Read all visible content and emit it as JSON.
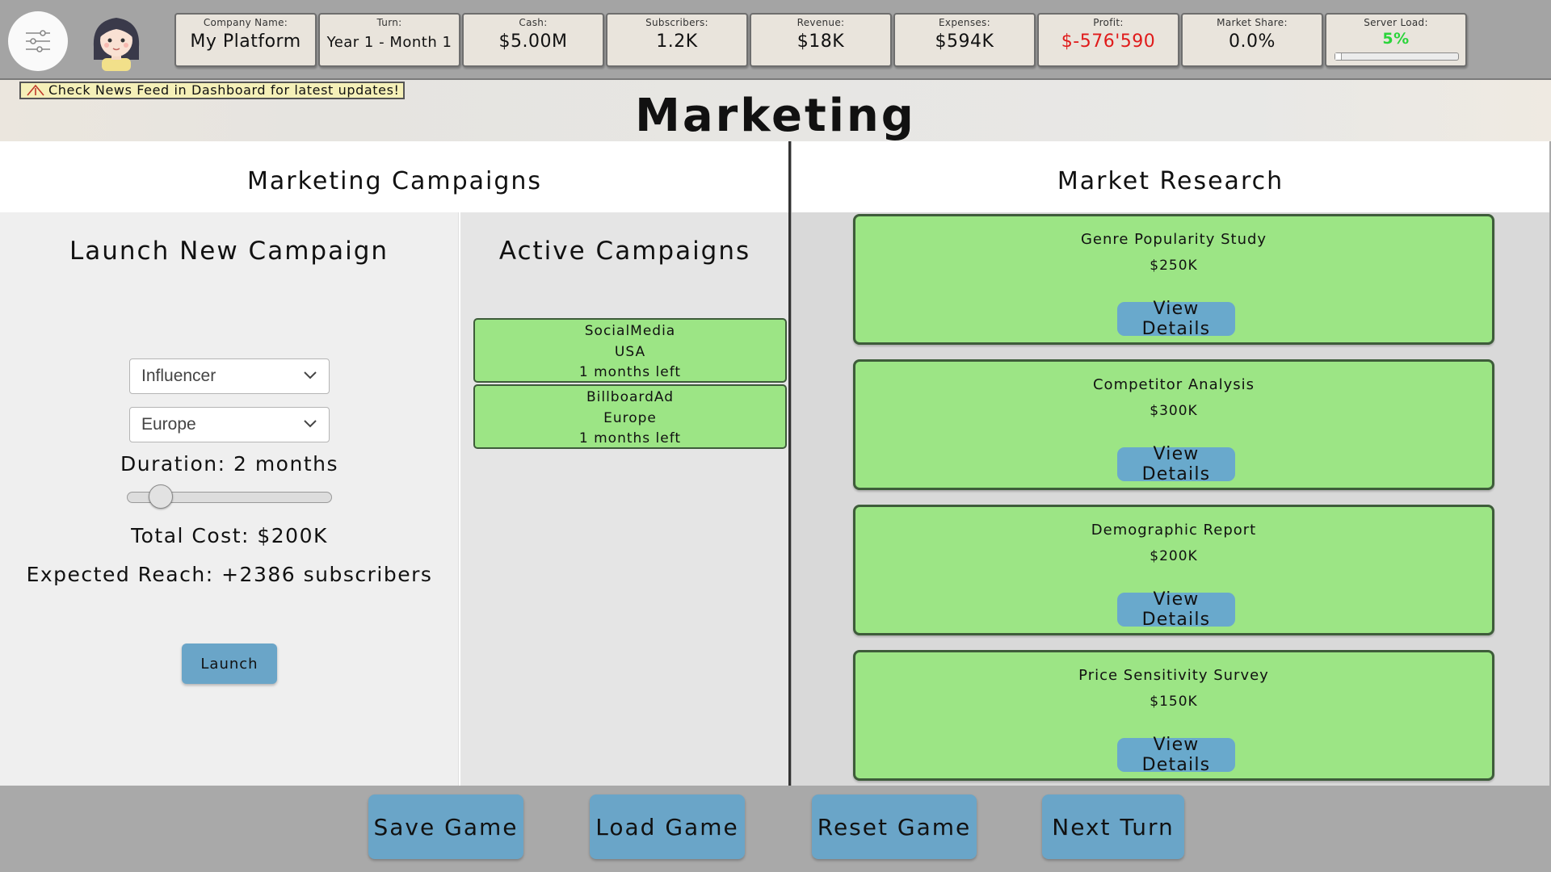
{
  "topbar": {
    "stats": [
      {
        "label": "Company Name:",
        "value": "My Platform"
      },
      {
        "label": "Turn:",
        "value": "Year 1 - Month 1"
      },
      {
        "label": "Cash:",
        "value": "$5.00M"
      },
      {
        "label": "Subscribers:",
        "value": "1.2K"
      },
      {
        "label": "Revenue:",
        "value": "$18K"
      },
      {
        "label": "Expenses:",
        "value": "$594K"
      },
      {
        "label": "Profit:",
        "value": "$-576'590"
      },
      {
        "label": "Market Share:",
        "value": "0.0%"
      },
      {
        "label": "Server Load:",
        "value": "5%"
      }
    ],
    "server_load_fraction": 0.05,
    "colors": {
      "negative": "#e01b1b",
      "good": "#2ad43a"
    }
  },
  "header": {
    "notice": "Check News Feed in Dashboard for latest updates!",
    "title": "Marketing"
  },
  "marketing": {
    "title": "Marketing Campaigns",
    "launch": {
      "title": "Launch New Campaign",
      "type_value": "Influencer",
      "region_value": "Europe",
      "duration_text": "Duration: 2 months",
      "duration_months": 2,
      "total_cost": "Total Cost: $200K",
      "expected_reach": "Expected Reach: +2386 subscribers",
      "launch_label": "Launch"
    },
    "active": {
      "title": "Active Campaigns",
      "campaigns": [
        {
          "type": "SocialMedia",
          "region": "USA",
          "remaining": "1 months left"
        },
        {
          "type": "BillboardAd",
          "region": "Europe",
          "remaining": "1 months left"
        }
      ]
    }
  },
  "research": {
    "title": "Market Research",
    "items": [
      {
        "name": "Genre Popularity Study",
        "cost": "$250K",
        "button": "View Details"
      },
      {
        "name": "Competitor Analysis",
        "cost": "$300K",
        "button": "View Details"
      },
      {
        "name": "Demographic Report",
        "cost": "$200K",
        "button": "View Details"
      },
      {
        "name": "Price Sensitivity Survey",
        "cost": "$150K",
        "button": "View Details"
      }
    ]
  },
  "footer": {
    "save": "Save Game",
    "load": "Load Game",
    "reset": "Reset Game",
    "next": "Next Turn"
  }
}
